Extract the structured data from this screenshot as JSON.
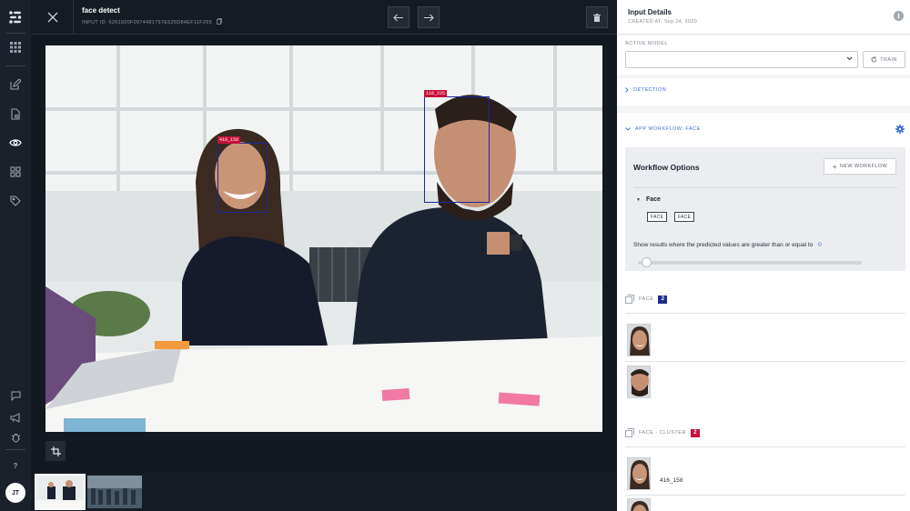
{
  "header": {
    "title": "face detect",
    "input_id": "INPUT ID: 6261920F0974481797E625D84EF11F265"
  },
  "image": {
    "boxes": [
      {
        "label": "416_158"
      },
      {
        "label": "118_225"
      }
    ]
  },
  "user": {
    "initials": "JT"
  },
  "panel": {
    "title": "Input Details",
    "created": "CREATED AT: Sep 24, 2020",
    "active_model_label": "ACTIVE MODEL",
    "active_model_value": "",
    "train_label": "TRAIN",
    "detection_label": "DETECTION",
    "app_workflow_label": "APP WORKFLOW: FACE",
    "workflow_options_title": "Workflow Options",
    "new_workflow_label": "NEW WORKFLOW",
    "model_name": "Face",
    "model_tags": [
      "FACE",
      "FACE"
    ],
    "threshold_text": "Show results where the predicted values are greater than or equal to",
    "threshold_value": "0",
    "threshold_fraction": 0,
    "concepts": [
      {
        "name": "FACE",
        "count": "2",
        "color": "#1d2c8f"
      },
      {
        "name": "FACE - CLUSTER",
        "count": "2",
        "color": "#c8103a"
      }
    ],
    "cluster_item_label": "416_158"
  },
  "colors": {
    "accent": "#3a6fd6",
    "box": "#1c2a9c",
    "label_bg": "#c8103a"
  }
}
